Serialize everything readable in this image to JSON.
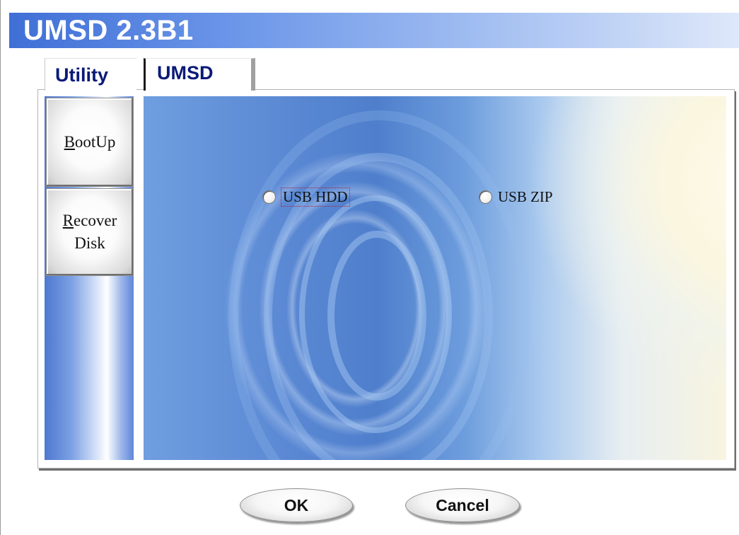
{
  "window": {
    "title": "UMSD 2.3B1"
  },
  "tabs": [
    {
      "label": "Utility",
      "active": true
    },
    {
      "label": "UMSD",
      "active": false
    }
  ],
  "sidebar": {
    "bootup": {
      "mnemonic": "B",
      "rest": "ootUp"
    },
    "recover": {
      "mnemonic": "R",
      "line1_rest": "ecover",
      "line2": "Disk"
    }
  },
  "options": {
    "usb_hdd": {
      "label": "USB HDD",
      "selected": false
    },
    "usb_zip": {
      "label": "USB ZIP",
      "selected": false
    }
  },
  "buttons": {
    "ok": "OK",
    "cancel": "Cancel"
  },
  "colors": {
    "title_gradient_start": "#3f6fd6",
    "tab_text": "#0a1a78"
  }
}
